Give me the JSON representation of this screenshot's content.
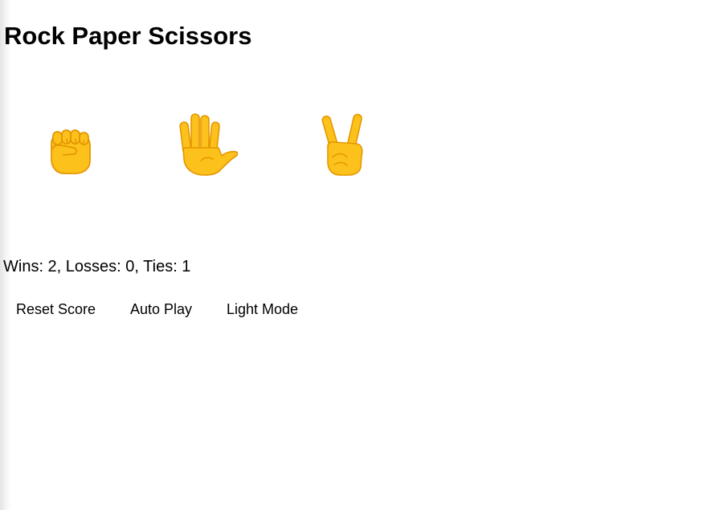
{
  "header": {
    "title": "Rock Paper Scissors"
  },
  "moves": [
    {
      "name": "rock",
      "icon": "raised-fist-icon"
    },
    {
      "name": "paper",
      "icon": "raised-hand-fingers-splayed-icon"
    },
    {
      "name": "scissors",
      "icon": "victory-hand-icon"
    }
  ],
  "score": {
    "text": "Wins: 2, Losses: 0, Ties: 1",
    "wins": 2,
    "losses": 0,
    "ties": 1
  },
  "controls": {
    "reset_label": "Reset Score",
    "auto_play_label": "Auto Play",
    "theme_label": "Light Mode"
  },
  "colors": {
    "emoji_fill": "#FCC21B",
    "emoji_line": "#E59600",
    "text": "#000000",
    "background": "#FFFFFF"
  }
}
